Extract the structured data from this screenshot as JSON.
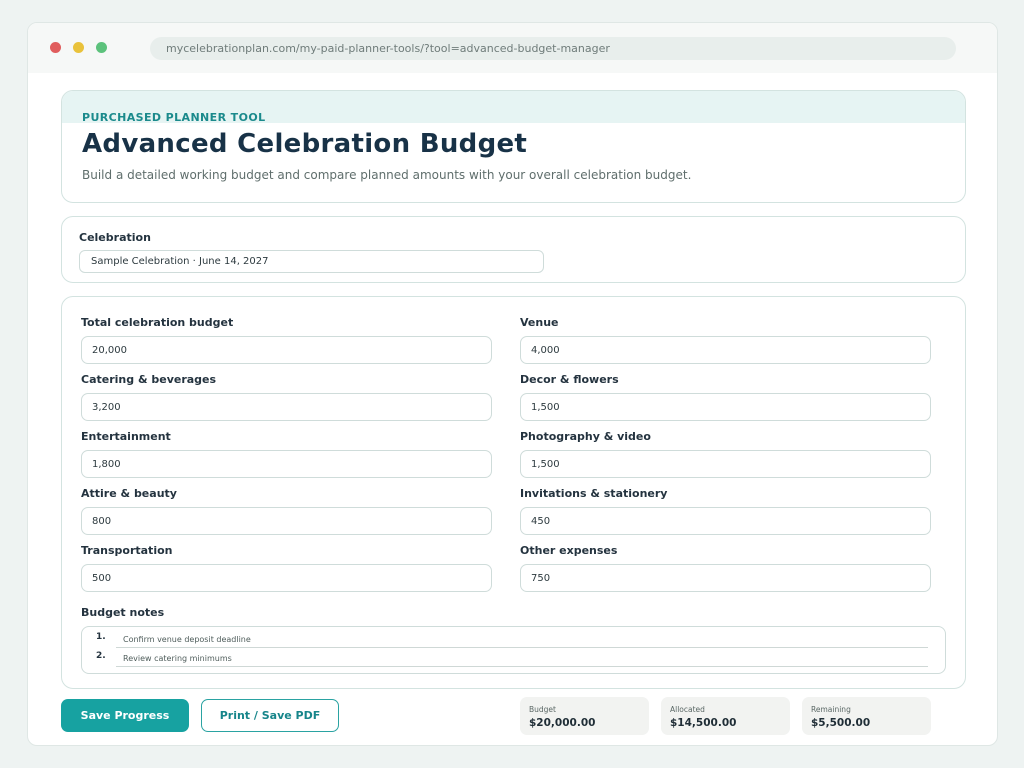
{
  "browser": {
    "url": "mycelebrationplan.com/my-paid-planner-tools/?tool=advanced-budget-manager"
  },
  "header": {
    "eyebrow": "PURCHASED PLANNER TOOL",
    "title": "Advanced Celebration Budget",
    "subtitle": "Build a detailed working budget and compare planned amounts with your overall celebration budget."
  },
  "celebration": {
    "label": "Celebration",
    "value": "Sample Celebration · June 14, 2027"
  },
  "fields": [
    {
      "label": "Total celebration budget",
      "value": "20,000"
    },
    {
      "label": "Venue",
      "value": "4,000"
    },
    {
      "label": "Catering & beverages",
      "value": "3,200"
    },
    {
      "label": "Decor & flowers",
      "value": "1,500"
    },
    {
      "label": "Entertainment",
      "value": "1,800"
    },
    {
      "label": "Photography & video",
      "value": "1,500"
    },
    {
      "label": "Attire & beauty",
      "value": "800"
    },
    {
      "label": "Invitations & stationery",
      "value": "450"
    },
    {
      "label": "Transportation",
      "value": "500"
    },
    {
      "label": "Other expenses",
      "value": "750"
    }
  ],
  "notes": {
    "label": "Budget notes",
    "items": [
      {
        "num": "1.",
        "text": "Confirm venue deposit deadline"
      },
      {
        "num": "2.",
        "text": "Review catering minimums"
      }
    ]
  },
  "actions": {
    "save_label": "Save Progress",
    "print_label": "Print / Save PDF"
  },
  "summary": [
    {
      "label": "Budget",
      "value": "$20,000.00"
    },
    {
      "label": "Allocated",
      "value": "$14,500.00"
    },
    {
      "label": "Remaining",
      "value": "$5,500.00"
    }
  ],
  "colors": {
    "accent": "#17a2a1",
    "title": "#183247",
    "eyebrow": "#1b8a8c"
  }
}
